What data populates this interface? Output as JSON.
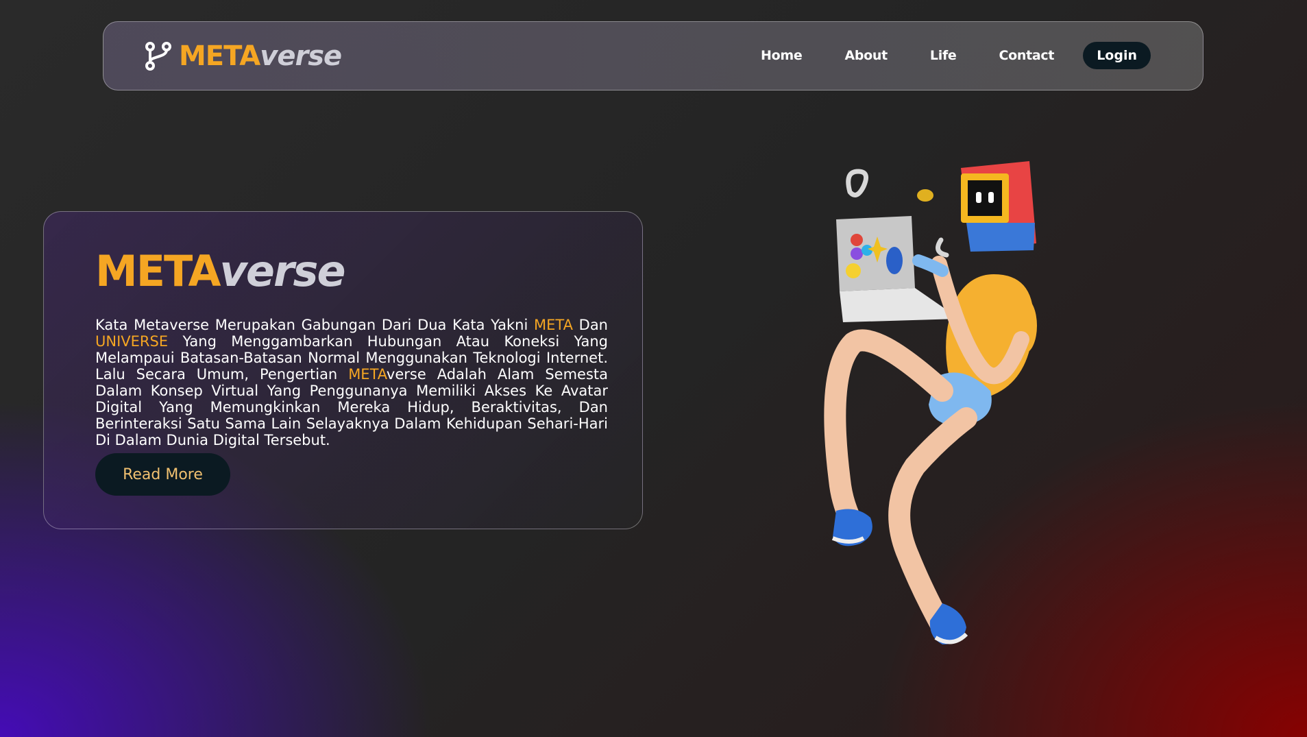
{
  "navbar": {
    "logo": {
      "meta": "META",
      "verse": "verse"
    },
    "links": [
      "Home",
      "About",
      "Life",
      "Contact"
    ],
    "login_label": "Login"
  },
  "hero": {
    "title_meta": "META",
    "title_verse": "verse",
    "body": {
      "p1": "Kata Metaverse Merupakan Gabungan Dari Dua Kata Yakni ",
      "h1": "META",
      "p2": " Dan ",
      "h2": "UNIVERSE",
      "p3": " Yang Menggambarkan Hubungan Atau Koneksi Yang Melampaui Batasan-Batasan Normal Menggunakan Teknologi Internet. Lalu Secara Umum, Pengertian ",
      "h3": "META",
      "p4": "verse Adalah Alam Semesta Dalam Konsep Virtual Yang Penggunanya Memiliki Akses Ke Avatar Digital Yang Memungkinkan Mereka Hidup, Beraktivitas, Dan Berinteraksi Satu Sama Lain Selayaknya Dalam Kehidupan Sehari-Hari Di Dalam Dunia Digital Tersebut."
    },
    "read_more_label": "Read More"
  },
  "colors": {
    "accent": "#f5a623",
    "button_bg": "#0b1a22",
    "gradient_left": "#4a0ab8",
    "gradient_right": "#8c0000"
  },
  "icons": {
    "logo": "branch-fork-icon"
  }
}
